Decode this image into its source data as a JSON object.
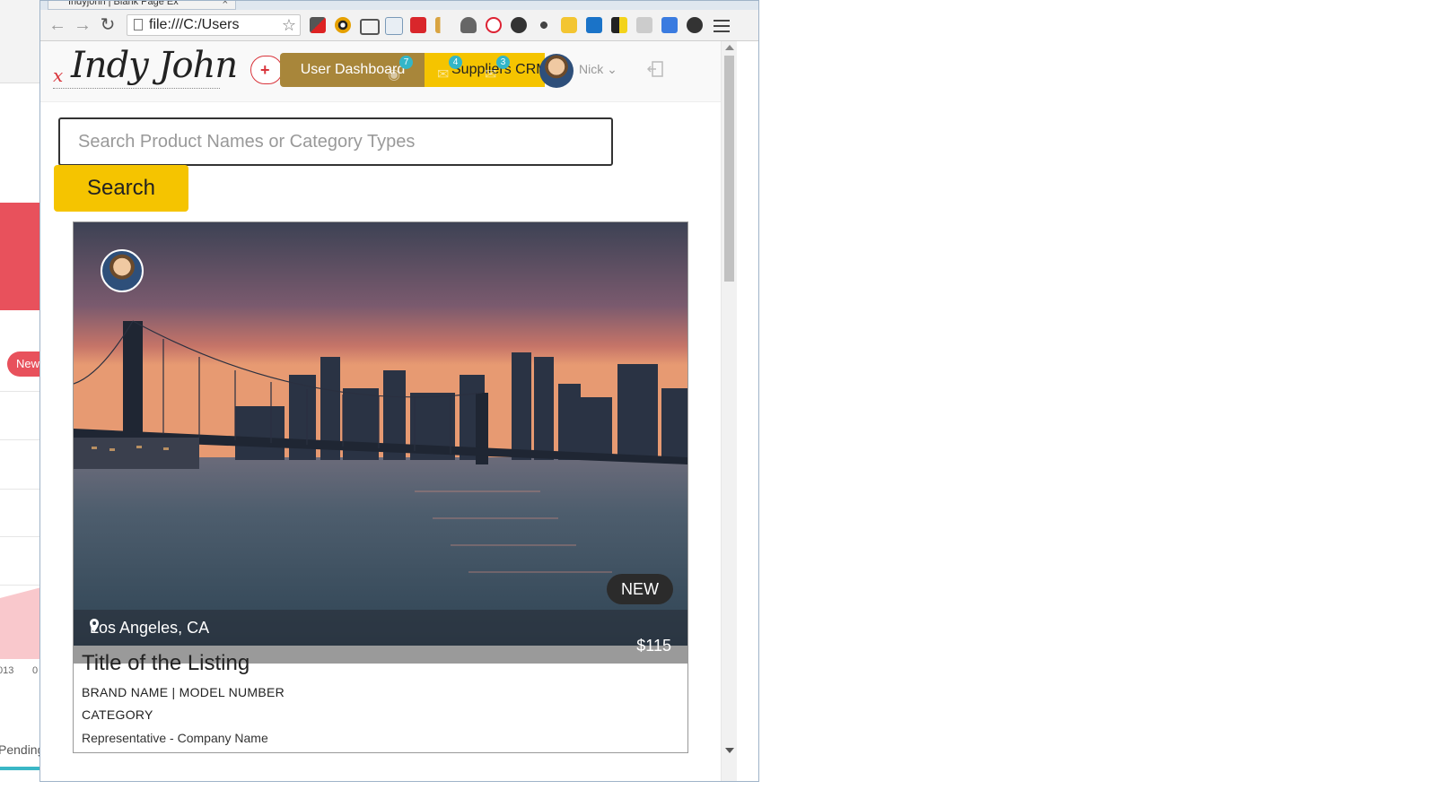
{
  "background_window": {
    "new_badge": "New",
    "tick_labels": [
      "013",
      "0"
    ],
    "pending_label": "Pending"
  },
  "browser": {
    "tab_title": "Indyjohn | Blank Page Ex",
    "tab_close": "×",
    "address": "file:///C:/Users",
    "back": "←",
    "forward": "→",
    "reload": "↻",
    "star": "☆"
  },
  "site": {
    "logo_mark": "x",
    "logo_text": "Indy John",
    "add_button": "+",
    "user_dashboard_label": "User Dashboard",
    "suppliers_label": "Suppliers CRM",
    "notifications_count": "7",
    "messages_count": "4",
    "alerts_count": "3",
    "user_name": "Nick",
    "user_caret": "⌄"
  },
  "search": {
    "placeholder": "Search Product Names or Category Types",
    "button_label": "Search"
  },
  "listing": {
    "badge": "NEW",
    "location": "Los Angeles, CA",
    "price": "$115",
    "title": "Title of the Listing",
    "brand_model": "BRAND NAME | MODEL NUMBER",
    "category": "CATEGORY",
    "representative": "Representative - Company Name"
  },
  "colors": {
    "accent_yellow": "#f5c400",
    "dashboard_gold": "#a8863a",
    "badge_teal": "#33b6c8",
    "brand_red": "#d9343b"
  }
}
